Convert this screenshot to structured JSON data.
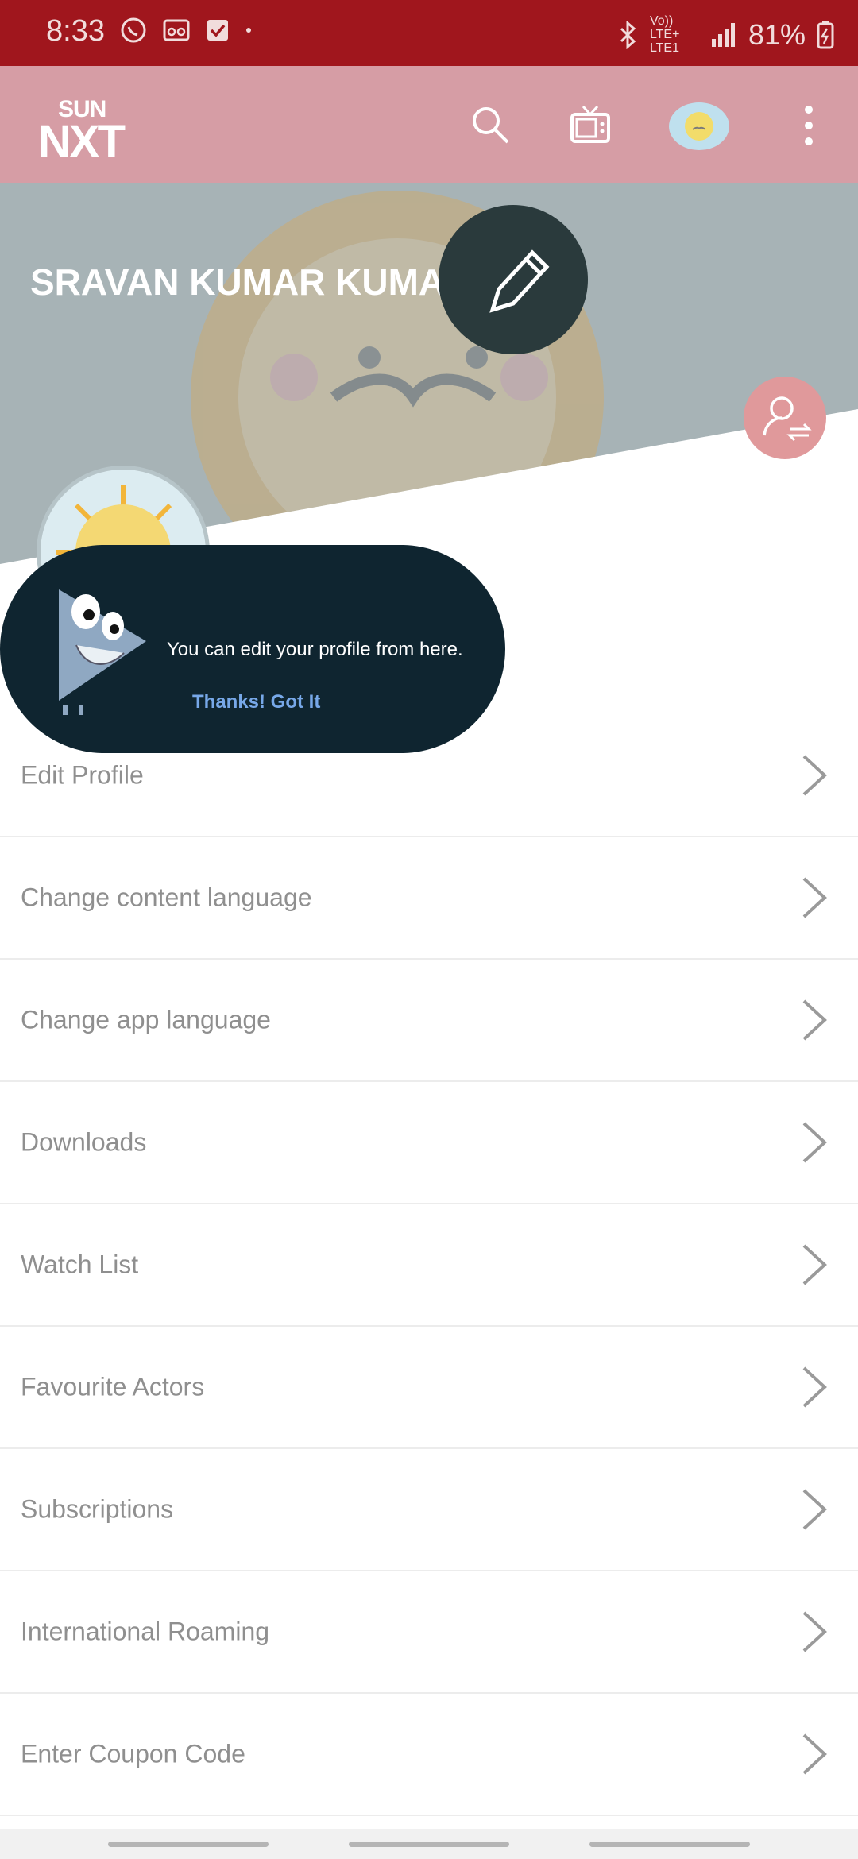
{
  "status_bar": {
    "time": "8:33",
    "network": "Vo)) LTE+ LTE1",
    "battery": "81%"
  },
  "app_bar": {
    "logo_top": "SUN",
    "logo_bottom": "NXT",
    "icons": [
      "search-icon",
      "tv-icon",
      "avatar",
      "more-vert-icon"
    ]
  },
  "profile": {
    "name": "SRAVAN KUMAR KUMAR"
  },
  "tooltip": {
    "message": "You can edit your profile from here.",
    "button": "Thanks! Got It"
  },
  "menu": [
    {
      "label": "Edit Profile"
    },
    {
      "label": "Change content language"
    },
    {
      "label": "Change app language"
    },
    {
      "label": "Downloads"
    },
    {
      "label": "Watch List"
    },
    {
      "label": "Favourite Actors"
    },
    {
      "label": "Subscriptions"
    },
    {
      "label": "International Roaming"
    },
    {
      "label": "Enter Coupon Code"
    }
  ],
  "colors": {
    "status_bar": "#a0161d",
    "app_bar": "#d69da5",
    "tooltip": "#0f2530",
    "tooltip_button": "#77a8e8"
  }
}
